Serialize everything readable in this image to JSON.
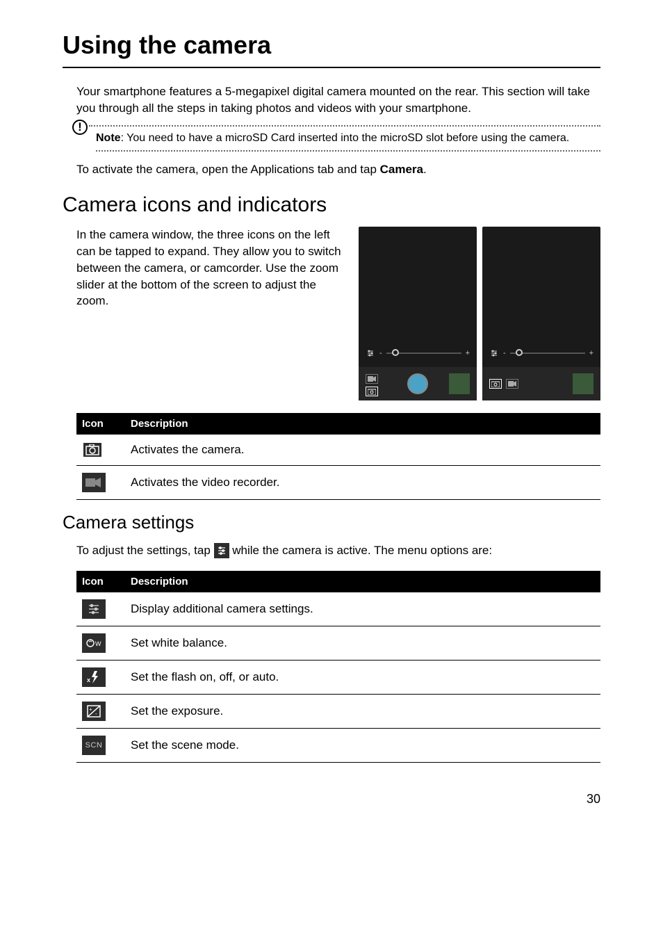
{
  "page_title": "Using the camera",
  "intro": "Your smartphone features a 5-megapixel digital camera mounted on the rear. This section will take you through all the steps in taking photos and videos with your smartphone.",
  "note_label": "Note",
  "note_text": ": You need to have a microSD Card inserted into the microSD slot before using the camera.",
  "activate_pre": "To activate the camera, open the Applications tab and tap ",
  "activate_bold": "Camera",
  "activate_post": ".",
  "section_icons_title": "Camera icons and indicators",
  "icons_para": "In the camera window, the three icons on the left can be tapped to expand. They allow you to switch between the camera, or camcorder. Use the zoom slider at the bottom of the screen to adjust the zoom.",
  "table1": {
    "headers": [
      "Icon",
      "Description"
    ],
    "rows": [
      {
        "icon": "camera-icon",
        "desc": "Activates the camera."
      },
      {
        "icon": "video-icon",
        "desc": "Activates the video recorder."
      }
    ]
  },
  "subsection_settings_title": "Camera settings",
  "settings_pre": "To adjust the settings, tap ",
  "settings_post": " while the camera is active. The menu options are:",
  "table2": {
    "headers": [
      "Icon",
      "Description"
    ],
    "rows": [
      {
        "icon": "sliders-icon",
        "desc": "Display additional camera settings."
      },
      {
        "icon": "white-balance-icon",
        "desc": "Set white balance."
      },
      {
        "icon": "flash-icon",
        "desc": "Set the flash on, off, or auto."
      },
      {
        "icon": "exposure-icon",
        "desc": "Set the exposure."
      },
      {
        "icon": "scene-icon",
        "desc": "Set the scene mode."
      }
    ]
  },
  "page_number": "30"
}
